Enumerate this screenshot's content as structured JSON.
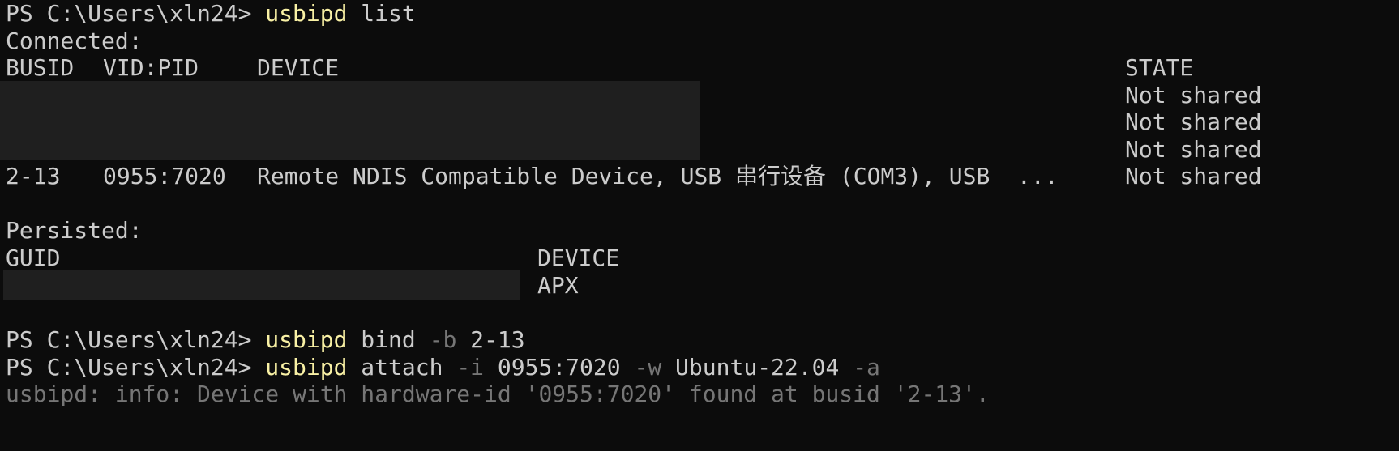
{
  "terminal": {
    "prompt": "PS C:\\Users\\xln24> ",
    "cmd1": {
      "command": "usbipd",
      "args": " list"
    },
    "connected_header": "Connected:",
    "connected_columns": {
      "busid": "BUSID",
      "vidpid": "VID:PID",
      "device": "DEVICE",
      "state": "STATE"
    },
    "connected_rows": [
      {
        "busid": "",
        "vidpid": "",
        "device": "",
        "state": "Not shared",
        "redacted": true
      },
      {
        "busid": "",
        "vidpid": "",
        "device": "",
        "state": "Not shared",
        "redacted": true
      },
      {
        "busid": "",
        "vidpid": "",
        "device": "",
        "state": "Not shared",
        "redacted": true
      },
      {
        "busid": "2-13",
        "vidpid": "0955:7020",
        "device": "Remote NDIS Compatible Device, USB 串行设备 (COM3), USB  ...",
        "state": "Not shared",
        "redacted": false
      }
    ],
    "persisted_header": "Persisted:",
    "persisted_columns": {
      "guid": "GUID",
      "device": "DEVICE"
    },
    "persisted_rows": [
      {
        "guid": "",
        "device": "APX",
        "redacted": true
      }
    ],
    "cmd2": {
      "command": "usbipd",
      "seg1": " bind ",
      "flag1": "-b",
      "seg2": " 2-13"
    },
    "cmd3": {
      "command": "usbipd",
      "seg1": " attach ",
      "flag1": "-i",
      "seg2": " 0955:7020 ",
      "flag2": "-w",
      "seg3": " Ubuntu-22.04 ",
      "flag3": "-a"
    },
    "info_message": "usbipd: info: Device with hardware-id '0955:7020' found at busid '2-13'."
  }
}
